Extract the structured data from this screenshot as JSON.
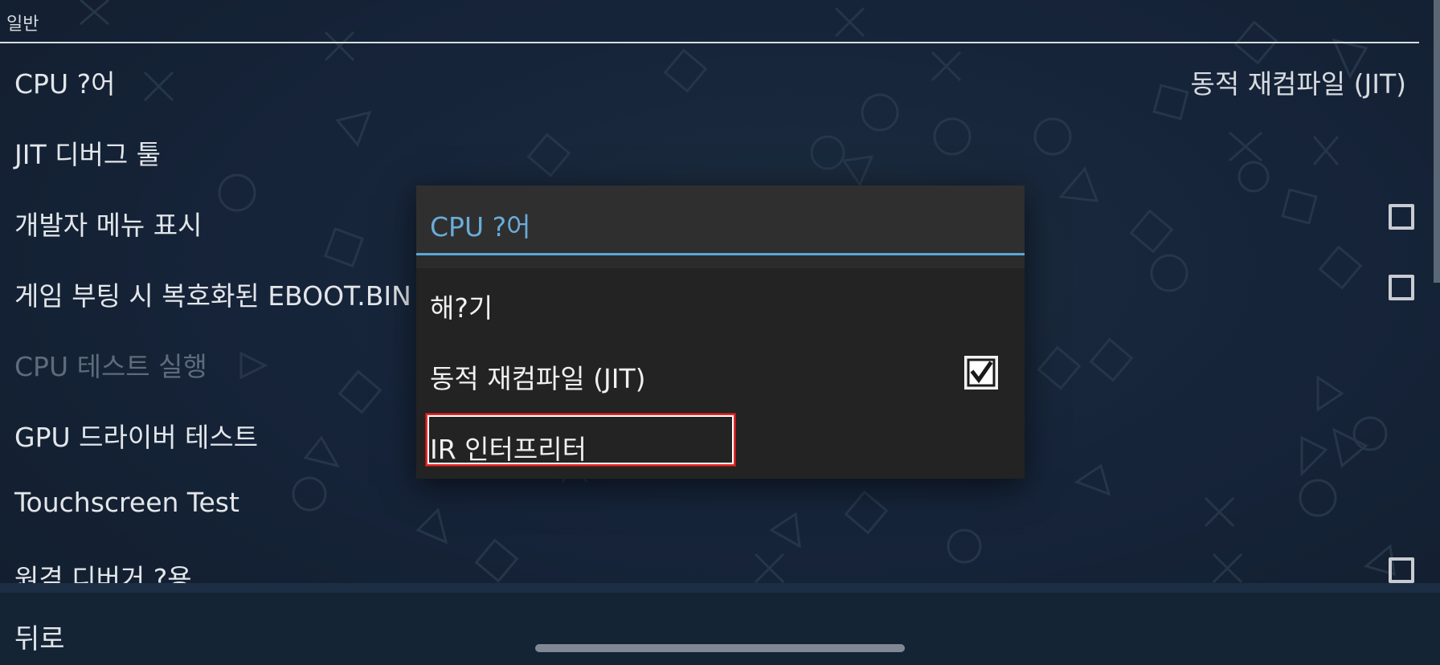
{
  "section": {
    "title": "일반"
  },
  "settings": [
    {
      "label": "CPU ?어",
      "value": "동적 재컴파일 (JIT)"
    },
    {
      "label": "JIT 디버그 툴"
    },
    {
      "label": "개발자 메뉴 표시",
      "checked": false
    },
    {
      "label": "게임 부팅 시 복호화된 EBOOT.BIN 덤프",
      "checked": false
    },
    {
      "label": "CPU 테스트 실행",
      "disabled": true
    },
    {
      "label": "GPU 드라이버 테스트"
    },
    {
      "label": "Touchscreen Test"
    },
    {
      "label": "원격 디버거 ?용",
      "checked": false
    }
  ],
  "footer": {
    "back_label": "뒤로"
  },
  "dialog": {
    "title": "CPU ?어",
    "options": [
      {
        "label": "해?기",
        "selected": false
      },
      {
        "label": "동적 재컴파일 (JIT)",
        "selected": true
      },
      {
        "label": "IR 인터프리터",
        "selected": false,
        "highlighted": true
      }
    ]
  },
  "colors": {
    "accent": "#5aa6d8",
    "background": "#152232",
    "dialog": "#232323",
    "highlight": "#e12a2a"
  },
  "icons": {
    "background": "playstation-shapes-pattern",
    "checkbox": "checkbox-icon",
    "checked": "check-icon"
  }
}
